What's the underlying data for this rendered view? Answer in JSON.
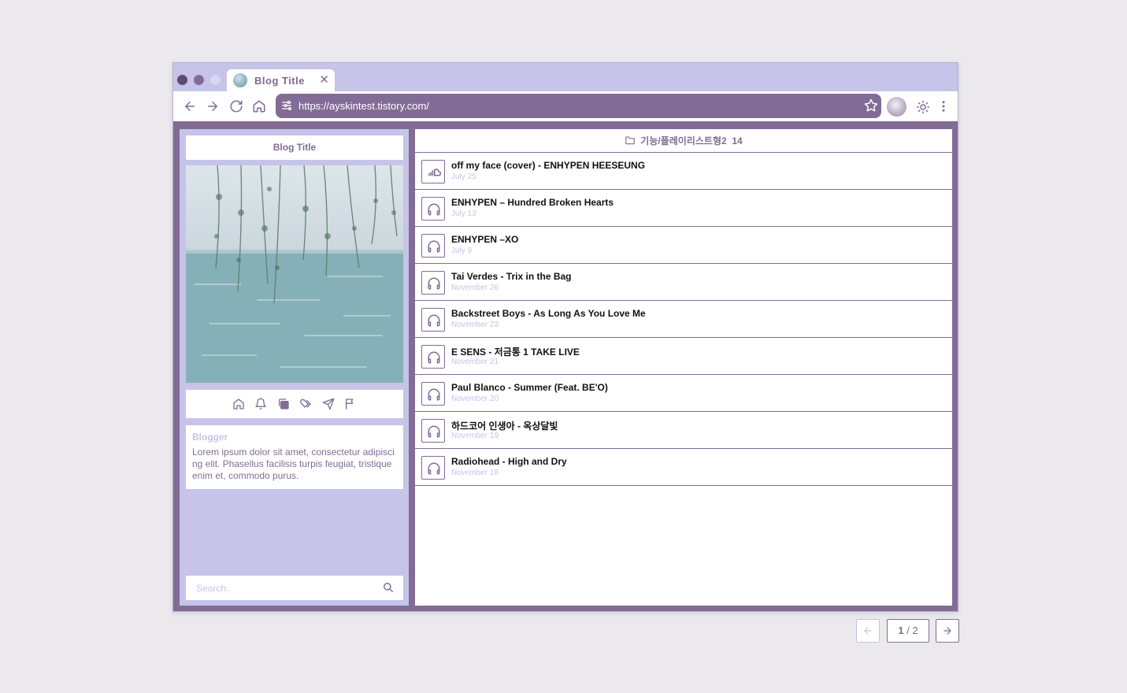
{
  "browser": {
    "tab_title": "Blog Title",
    "tab_close": "✕",
    "url": "https://ayskintest.tistory.com/"
  },
  "sidebar": {
    "blog_title": "Blog Title",
    "nav_icons": [
      "home-icon",
      "bell-icon",
      "copy-icon",
      "tags-icon",
      "send-icon",
      "flag-icon"
    ],
    "blogger_label": "Blogger",
    "description": "Lorem ipsum dolor sit amet, consectetur adipiscing elit. Phasellus facilisis turpis feugiat, tristique enim et, commodo purus.",
    "search_placeholder": "Search.."
  },
  "main": {
    "category": "기능/플레이리스트형2",
    "count": "14",
    "posts": [
      {
        "title": "off my face (cover) - ENHYPEN HEESEUNG",
        "date": "July 25",
        "icon": "soundcloud-icon"
      },
      {
        "title": "ENHYPEN – Hundred Broken Hearts",
        "date": "July 13",
        "icon": "headphones-icon"
      },
      {
        "title": "ENHYPEN –XO",
        "date": "July 9",
        "icon": "headphones-icon"
      },
      {
        "title": "Tai Verdes - Trix in the Bag",
        "date": "November 26",
        "icon": "headphones-icon"
      },
      {
        "title": "Backstreet Boys - As Long As You Love Me",
        "date": "November 23",
        "icon": "headphones-icon"
      },
      {
        "title": "E SENS - 저금통 1 TAKE LIVE",
        "date": "November 21",
        "icon": "headphones-icon"
      },
      {
        "title": "Paul Blanco - Summer (Feat. BE'O)",
        "date": "November 20",
        "icon": "headphones-icon"
      },
      {
        "title": "하드코어 인생아 - 옥상달빛",
        "date": "November 19",
        "icon": "headphones-icon"
      },
      {
        "title": "Radiohead - High and Dry",
        "date": "November 18",
        "icon": "headphones-icon"
      }
    ]
  },
  "pagination": {
    "current": "1",
    "separator": "/",
    "total": "2"
  },
  "colors": {
    "accent": "#826c96",
    "light": "#c6c4e8"
  }
}
